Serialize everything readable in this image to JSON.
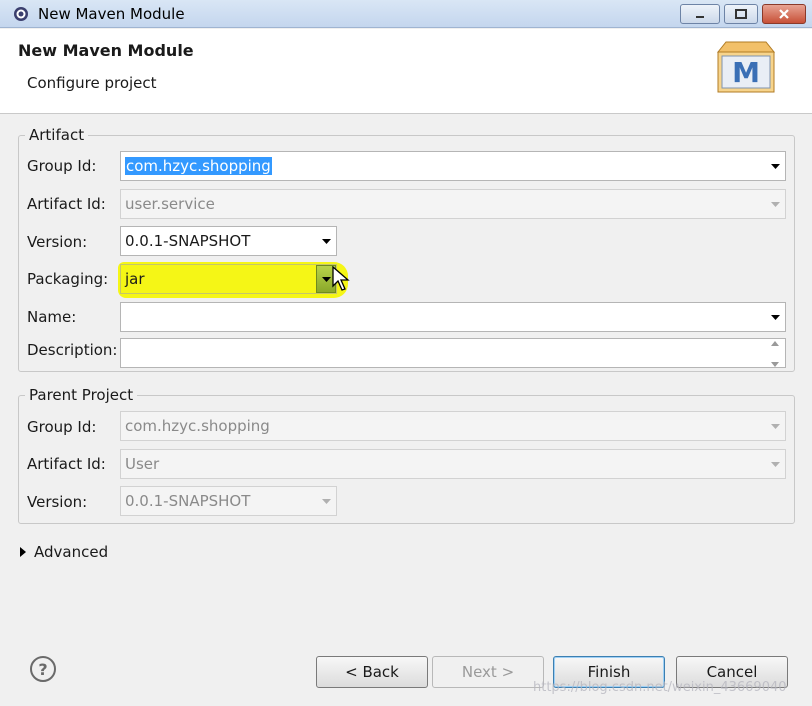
{
  "window": {
    "title": "New Maven Module"
  },
  "header": {
    "title": "New Maven Module",
    "subtitle": "Configure project",
    "logo_letter": "M"
  },
  "artifact": {
    "legend": "Artifact",
    "group_id": {
      "label": "Group Id:",
      "value": "com.hzyc.shopping"
    },
    "artifact_id": {
      "label": "Artifact Id:",
      "value": "user.service"
    },
    "version": {
      "label": "Version:",
      "value": "0.0.1-SNAPSHOT"
    },
    "packaging": {
      "label": "Packaging:",
      "value": "jar"
    },
    "name": {
      "label": "Name:",
      "value": ""
    },
    "description": {
      "label": "Description:",
      "value": ""
    }
  },
  "parent": {
    "legend": "Parent Project",
    "group_id": {
      "label": "Group Id:",
      "value": "com.hzyc.shopping"
    },
    "artifact_id": {
      "label": "Artifact Id:",
      "value": "User"
    },
    "version": {
      "label": "Version:",
      "value": "0.0.1-SNAPSHOT"
    }
  },
  "advanced": {
    "label": "Advanced"
  },
  "buttons": {
    "back": "< Back",
    "next": "Next >",
    "finish": "Finish",
    "cancel": "Cancel"
  },
  "help": {
    "glyph": "?"
  },
  "watermark": "https://blog.csdn.net/weixin_43669040",
  "colors": {
    "selection": "#3399ff",
    "highlight": "#f4f50a"
  }
}
